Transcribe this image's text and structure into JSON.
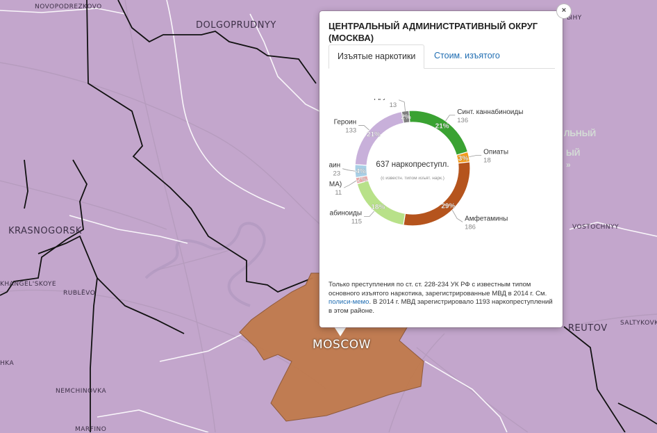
{
  "map": {
    "labels": [
      {
        "name": "novopodrezkovo",
        "text": "NOVOPODREZKOVO"
      },
      {
        "name": "dolgoprudnyy",
        "text": "DOLGOPRUDNYY"
      },
      {
        "name": "krasnogorsk",
        "text": "KRASNOGORSK"
      },
      {
        "name": "khangelskoye",
        "text": "KHANGEL'SKOYE"
      },
      {
        "name": "rublevo",
        "text": "RUBLËVO"
      },
      {
        "name": "vostochnyy",
        "text": "VOSTOCHNYY"
      },
      {
        "name": "reutov",
        "text": "REUTOV"
      },
      {
        "name": "saltykovka",
        "text": "SALTYKOVK"
      },
      {
        "name": "moscow",
        "text": "MOSCOW"
      },
      {
        "name": "nemchinovka",
        "text": "NEMCHINOVKA"
      },
      {
        "name": "marfino",
        "text": "MARFINO"
      },
      {
        "name": "khimki-partial",
        "text": "HKA"
      },
      {
        "name": "lobnya-partial",
        "text": "ЫНҮ"
      }
    ],
    "faint_labels": [
      "ЛЬНЫЙ",
      "ЫЙ",
      "»"
    ],
    "colors": {
      "map_bg": "#c3a6cc",
      "district_fill": "#c07a4c"
    }
  },
  "popup": {
    "title": "ЦЕНТРАЛЬНЫЙ АДМИНИСТРАТИВНЫЙ ОКРУГ (МОСКВА)",
    "tabs": [
      {
        "label": "Изъятые наркотики",
        "active": true
      },
      {
        "label": "Стоим. изъятого",
        "active": false
      }
    ],
    "note_before": "Только преступления по ст. ст. 228-234 УК РФ с известным типом основного изъятого наркотика, зарегистрированные МВД в 2014 г. См. ",
    "note_link": "полиси-мемо",
    "note_after": ". В 2014 г. МВД зарегистрировало 1193 наркопреступлений в этом районе.",
    "close_label": "×"
  },
  "chart_data": {
    "type": "pie",
    "center_label": "637 наркопреступл.",
    "center_sublabel": "(с известн. типом изъят. нарк.)",
    "slices": [
      {
        "label": "Синт. каннабиноиды",
        "value": 136,
        "percent": "21%",
        "color": "#3aa232"
      },
      {
        "label": "Опиаты",
        "value": 18,
        "percent": "3%",
        "color": "#f39c1d"
      },
      {
        "label": "Амфетамины",
        "value": 186,
        "percent": "29%",
        "color": "#b5541d"
      },
      {
        "label": "Каннабиноиды",
        "value": 115,
        "percent": "18%",
        "color": "#b8e189"
      },
      {
        "label": "Экстази (MDMA)",
        "value": 11,
        "percent": "2%",
        "color": "#f0a8a8"
      },
      {
        "label": "Кокаин",
        "value": 23,
        "percent": "4%",
        "color": "#a8cfe6"
      },
      {
        "label": "Героин",
        "value": 133,
        "percent": "21%",
        "color": "#c8b0da"
      },
      {
        "label": "Другие",
        "value": 13,
        "percent": "2%",
        "color": "#808080"
      }
    ]
  }
}
